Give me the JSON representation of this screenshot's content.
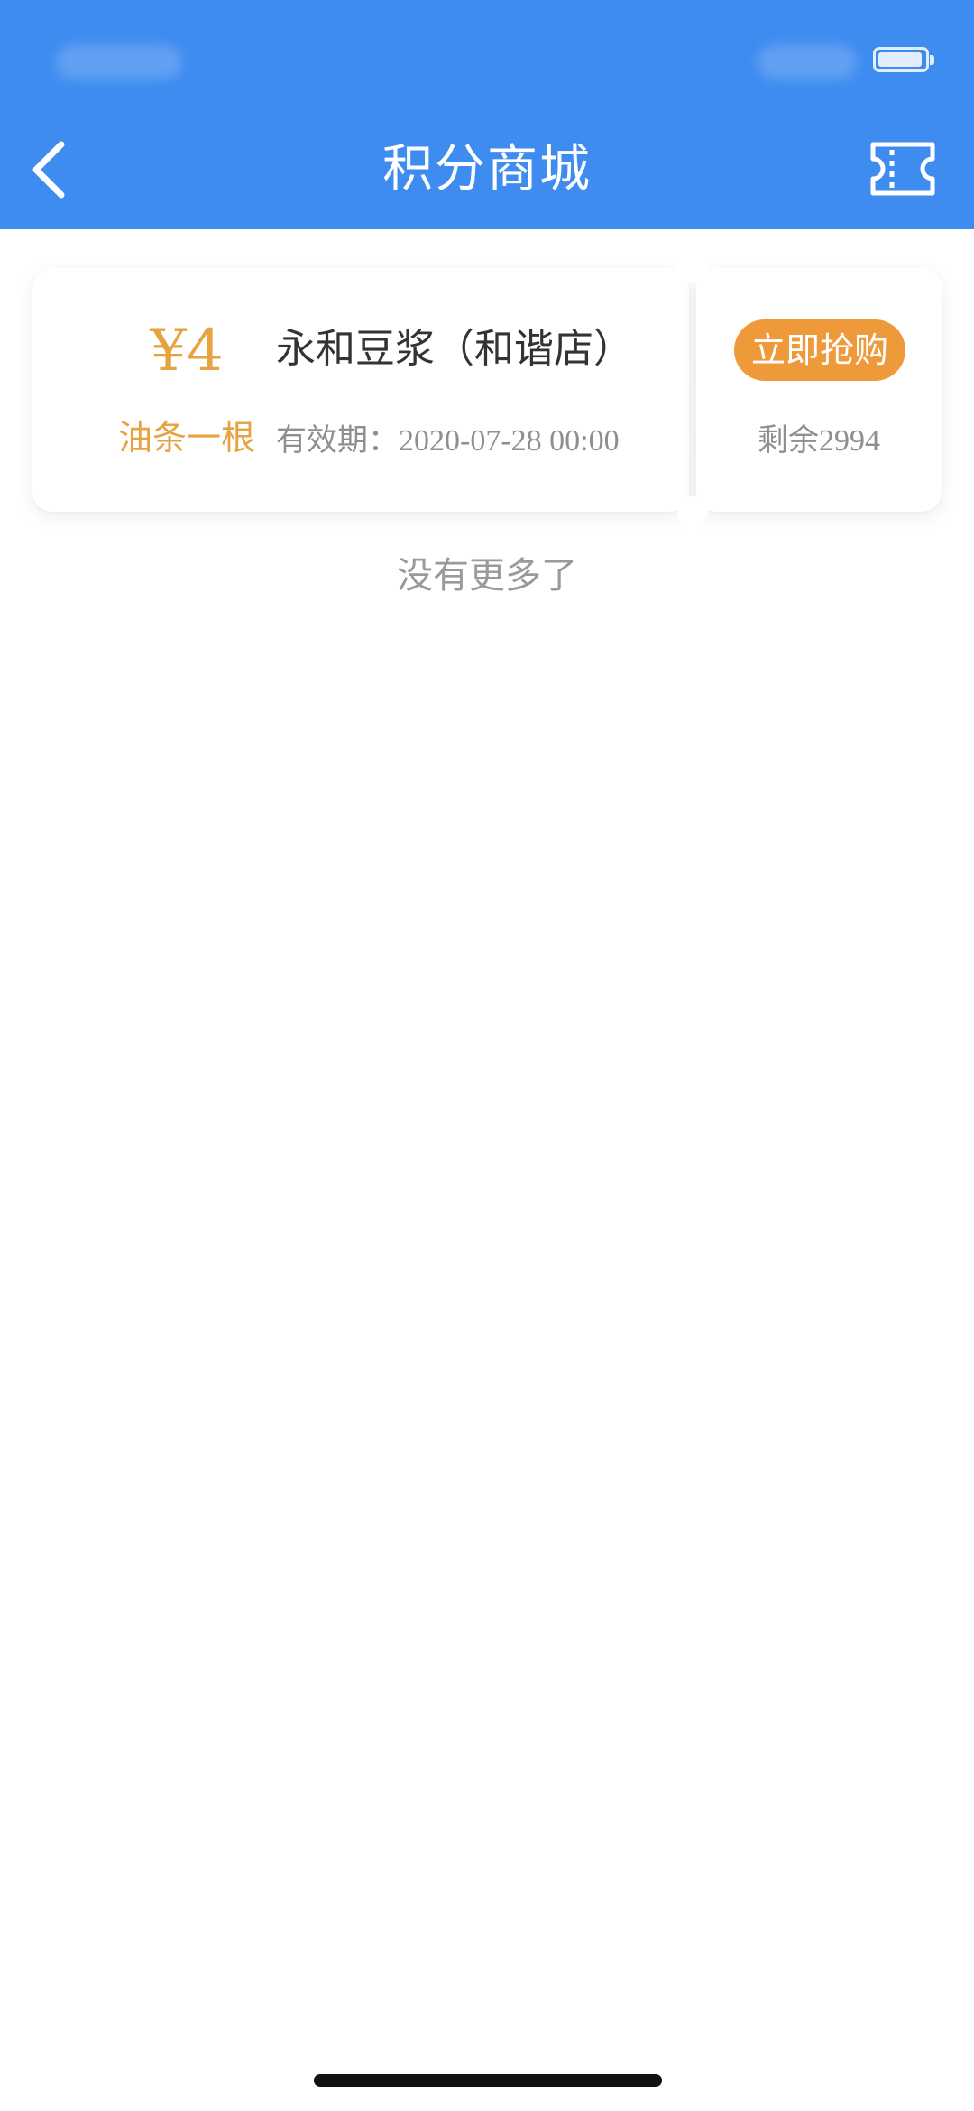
{
  "header": {
    "title": "积分商城",
    "background_color": "#3f8cf0",
    "back_icon": "chevron-left-icon",
    "right_icon": "ticket-icon"
  },
  "coupons": [
    {
      "price": "¥4",
      "description": "油条一根",
      "merchant": "永和豆浆（和谐店）",
      "validity": "有效期：2020-07-28 00:00",
      "buy_label": "立即抢购",
      "remaining": "剩余2994",
      "accent_color": "#e6a33f",
      "button_color": "#ee9a3a"
    }
  ],
  "list_end_text": "没有更多了"
}
